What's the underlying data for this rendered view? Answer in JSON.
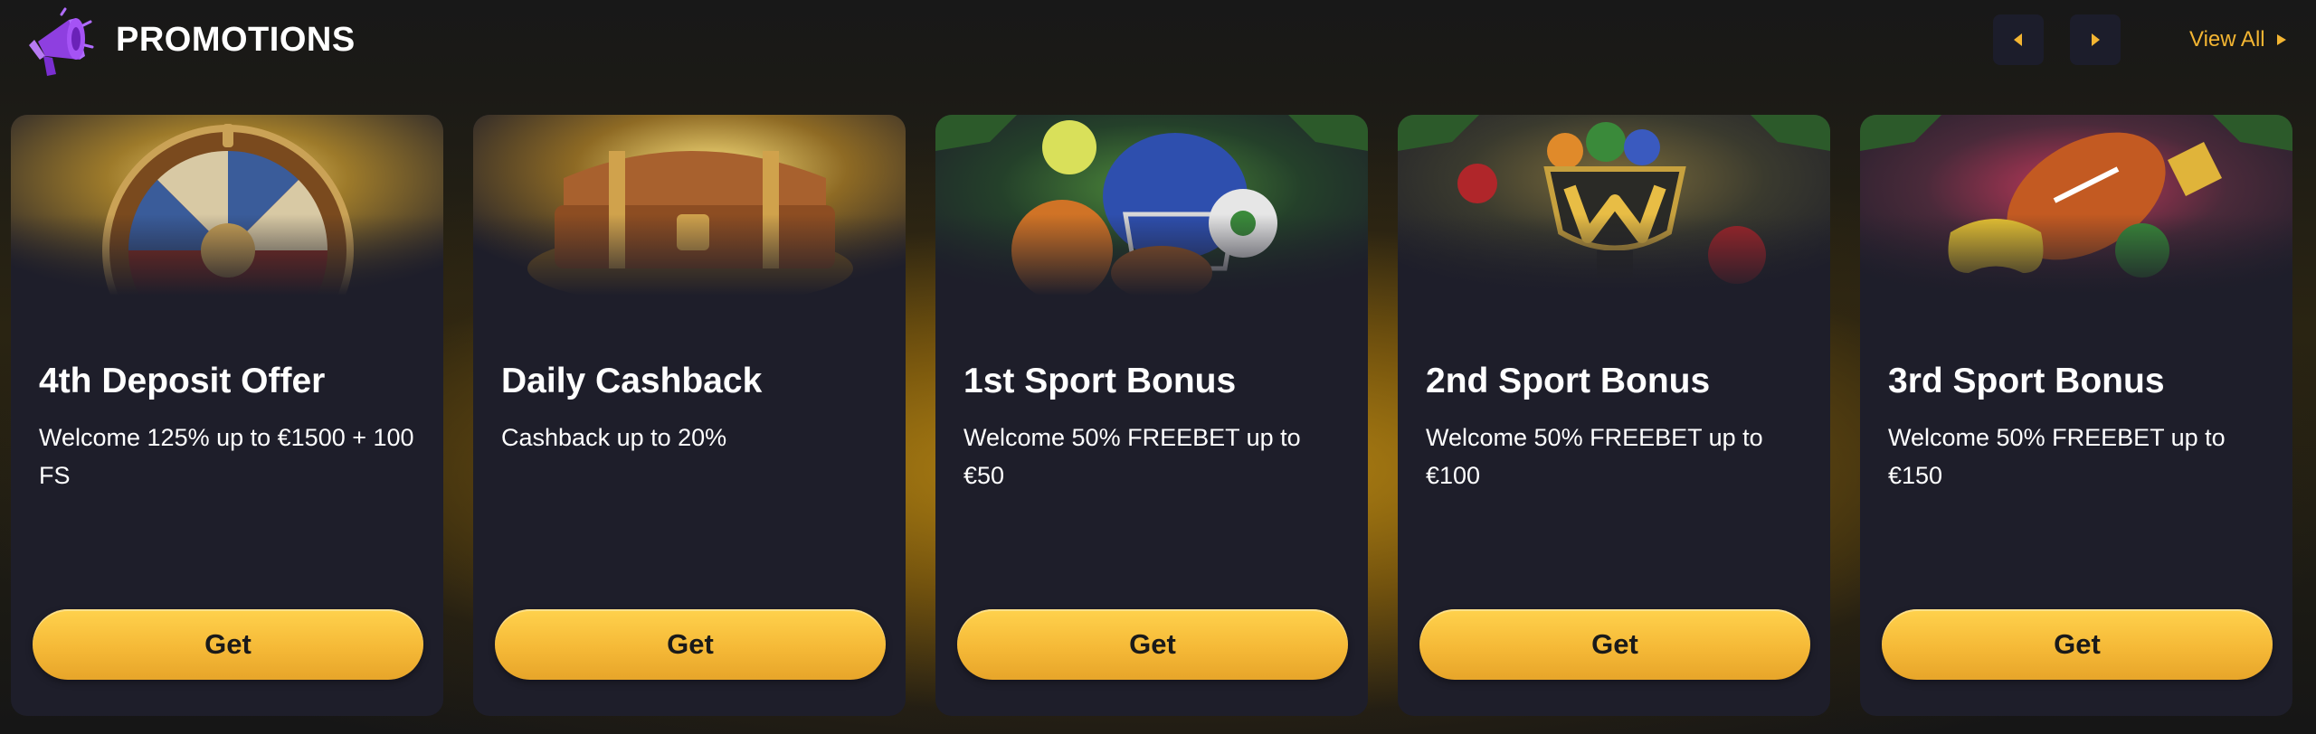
{
  "header": {
    "title": "PROMOTIONS",
    "view_all_label": "View All",
    "icons": {
      "section": "megaphone-icon",
      "prev": "caret-left-icon",
      "next": "caret-right-icon",
      "view_all": "caret-right-icon"
    }
  },
  "colors": {
    "accent": "#f3b532",
    "card_bg": "#1e1e2a",
    "button_top": "#ffd24d",
    "button_bottom": "#e7a52a",
    "nav_button_bg": "#1c1d2b",
    "megaphone": "#8e3fe0"
  },
  "cards": [
    {
      "title": "4th Deposit Offer",
      "description": "Welcome 125% up to €1500 + 100 FS",
      "button_label": "Get",
      "image_subject": "fortune wheel"
    },
    {
      "title": "Daily Cashback",
      "description": "Cashback up to 20%",
      "button_label": "Get",
      "image_subject": "treasure chest"
    },
    {
      "title": "1st Sport Bonus",
      "description": "Welcome 50% FREEBET up to €50",
      "button_label": "Get",
      "image_subject": "sports balls and helmet"
    },
    {
      "title": "2nd Sport Bonus",
      "description": "Welcome 50% FREEBET up to €100",
      "button_label": "Get",
      "image_subject": "trophy with balls"
    },
    {
      "title": "3rd Sport Bonus",
      "description": "Welcome 50% FREEBET up to €150",
      "button_label": "Get",
      "image_subject": "football and gamepad"
    }
  ]
}
